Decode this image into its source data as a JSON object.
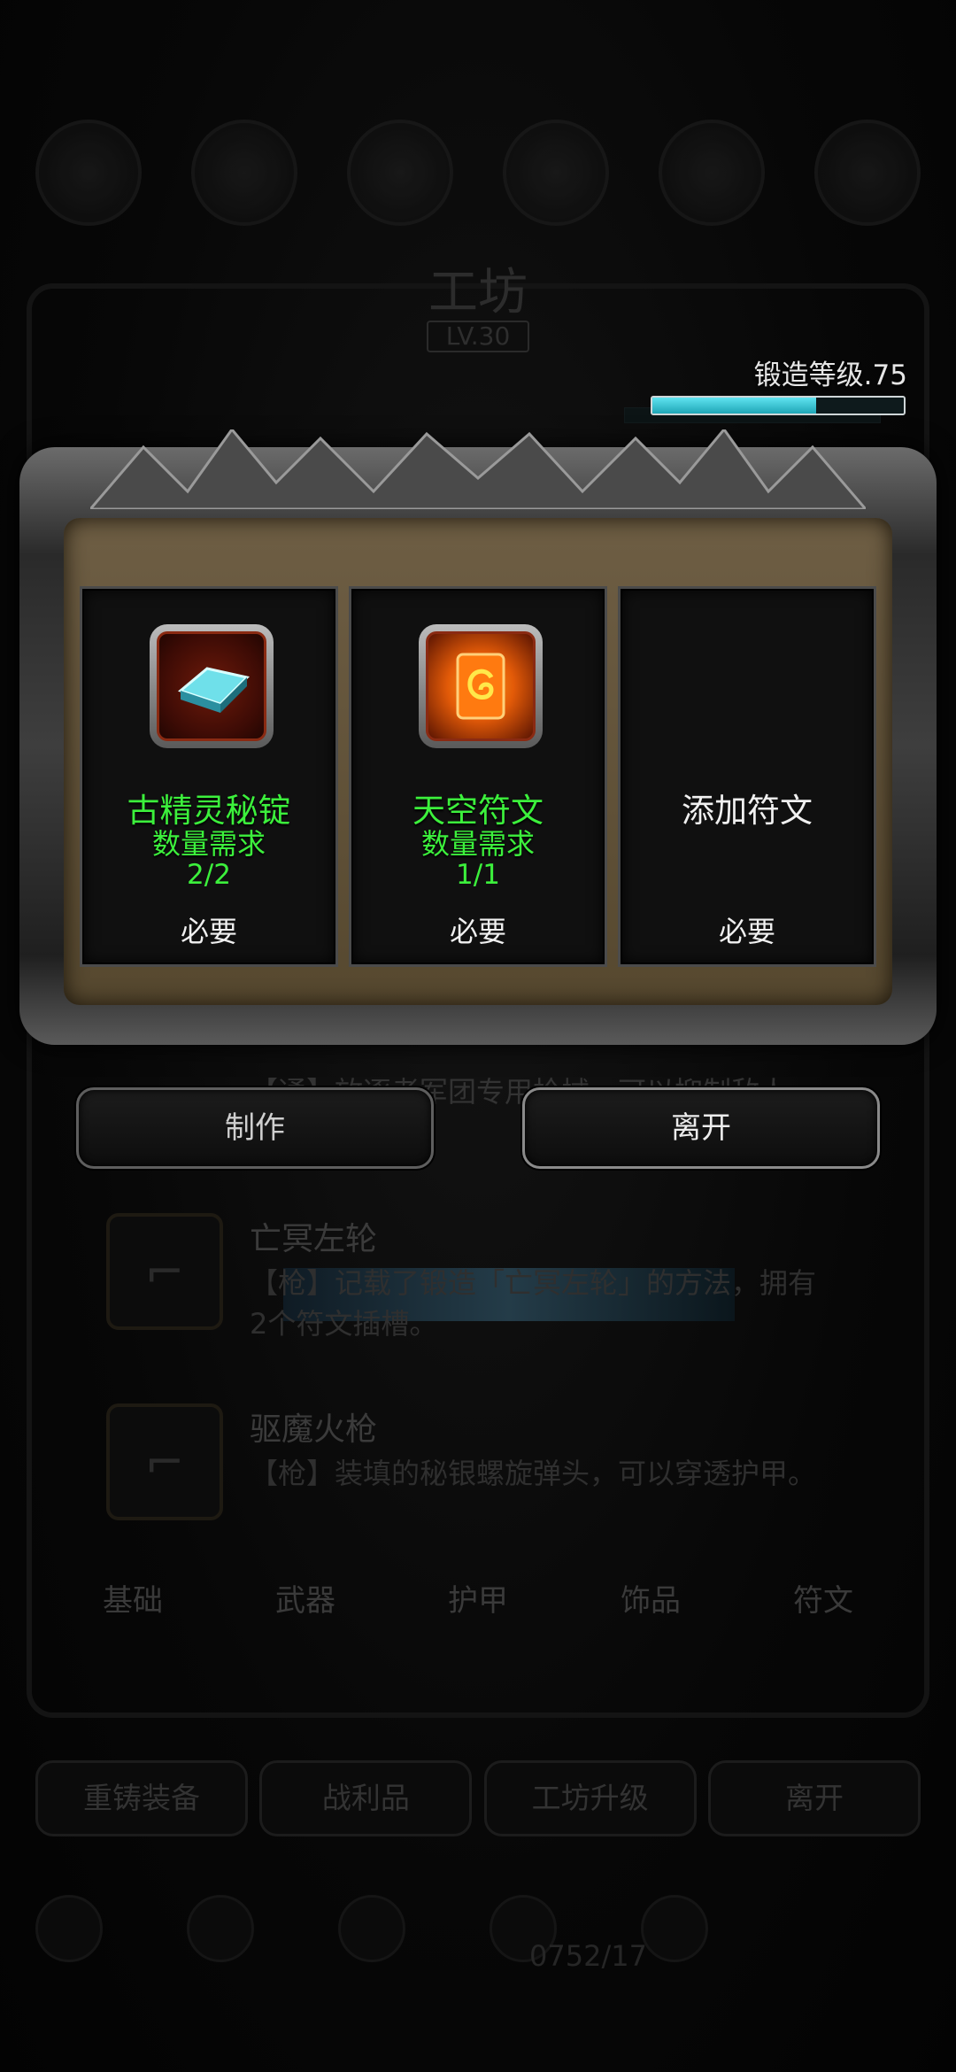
{
  "workshop": {
    "title": "工坊",
    "level": "LV.30",
    "forge_label": "锻造等级.75",
    "forge_progress": 0.65
  },
  "background_items": [
    {
      "name": "亡冥左轮",
      "desc": "【枪】记载了锻造「亡冥左轮」的方法，拥有2个符文插槽。"
    },
    {
      "name": "驱魔火枪",
      "desc": "【枪】装填的秘银螺旋弹头，可以穿透护甲。"
    }
  ],
  "partial_item": {
    "desc": "【通】放逐者军团专用枪械，可以抑制敌人 …符文插槽"
  },
  "tabs": [
    "基础",
    "武器",
    "护甲",
    "饰品",
    "符文"
  ],
  "bottom_buttons": [
    "重铸装备",
    "战利品",
    "工坊升级",
    "离开"
  ],
  "bottom_counter": "0752/17",
  "modal": {
    "slots": [
      {
        "title": "古精灵秘锭",
        "req": "数量需求",
        "count": "2/2",
        "need": "必要",
        "icon": "ingot-icon"
      },
      {
        "title": "天空符文",
        "req": "数量需求",
        "count": "1/1",
        "need": "必要",
        "icon": "rune-icon"
      },
      {
        "title": "添加符文",
        "need": "必要"
      }
    ],
    "craft_label": "制作",
    "leave_label": "离开"
  },
  "colors": {
    "requirement_green": "#3cf03c",
    "progress_cyan": "#3fc8d8",
    "frame_brown": "#6e5e44"
  }
}
